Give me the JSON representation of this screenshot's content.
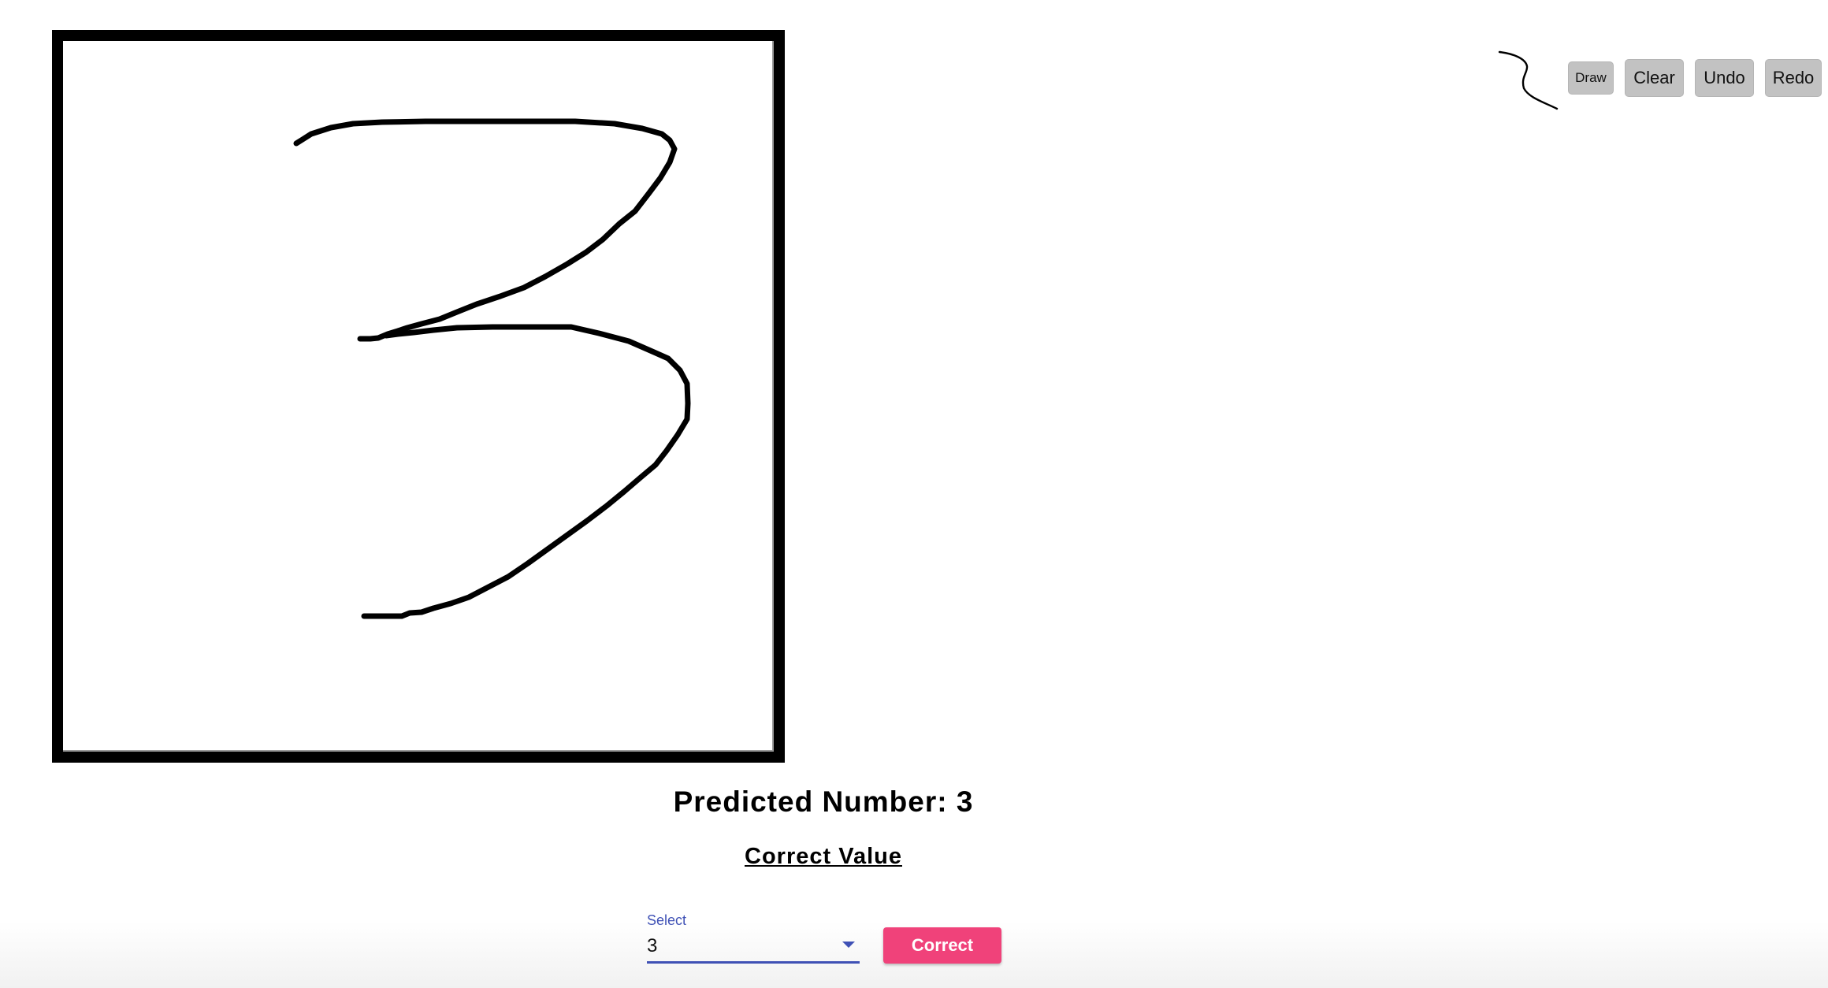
{
  "toolbar": {
    "draw_label": "Draw",
    "clear_label": "Clear",
    "undo_label": "Undo",
    "redo_label": "Redo"
  },
  "canvas": {
    "stroke_color": "#000000",
    "border_color": "#000000"
  },
  "result": {
    "predicted_text": "Predicted Number: 3",
    "correct_heading": "Correct Value"
  },
  "select": {
    "label": "Select",
    "value": "3"
  },
  "correct_button": {
    "label": "Correct"
  },
  "colors": {
    "accent": "#3f51b5",
    "button_pink": "#f0427a",
    "tool_button_bg": "#c2c2c2"
  }
}
